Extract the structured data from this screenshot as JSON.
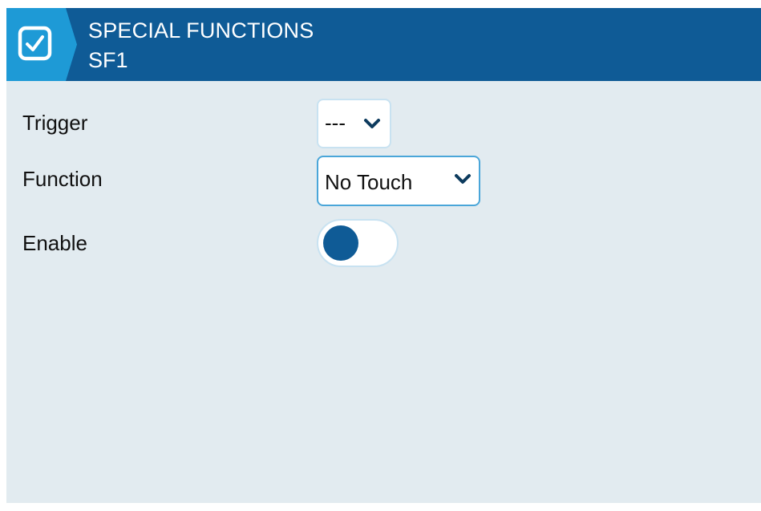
{
  "header": {
    "title": "SPECIAL FUNCTIONS",
    "subtitle": "SF1",
    "icon": "checkbox-icon",
    "colors": {
      "bar": "#0f5b96",
      "tab": "#1e9ad6",
      "text": "#ffffff"
    }
  },
  "form": {
    "trigger": {
      "label": "Trigger",
      "value": "---"
    },
    "function": {
      "label": "Function",
      "value": "No Touch"
    },
    "enable": {
      "label": "Enable",
      "state": "off"
    }
  },
  "colors": {
    "background": "#e2ebf0",
    "accent": "#0f5b96",
    "focus_border": "#4aa6d9"
  }
}
